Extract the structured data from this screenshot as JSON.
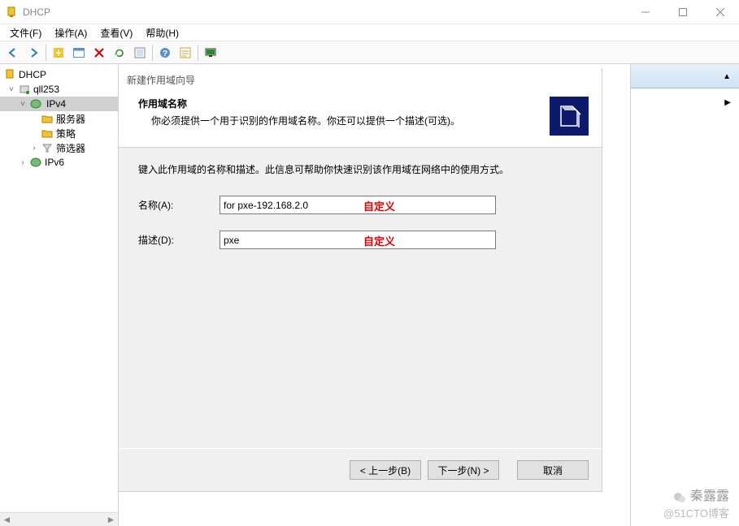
{
  "window": {
    "title": "DHCP"
  },
  "menu": {
    "file": "文件(F)",
    "action": "操作(A)",
    "view": "查看(V)",
    "help": "帮助(H)"
  },
  "tree": {
    "root": "DHCP",
    "server": "qll253",
    "ipv4": "IPv4",
    "srvopt": "服务器",
    "policy": "策略",
    "filter": "筛选器",
    "ipv6": "IPv6"
  },
  "wizard": {
    "dlgtitle": "新建作用域向导",
    "heading": "作用域名称",
    "subheading": "你必须提供一个用于识别的作用域名称。你还可以提供一个描述(可选)。",
    "instruction": "键入此作用域的名称和描述。此信息可帮助你快速识别该作用域在网络中的使用方式。",
    "name_label": "名称(A):",
    "name_value": "for pxe-192.168.2.0",
    "desc_label": "描述(D):",
    "desc_value": "pxe",
    "custom1": "自定义",
    "custom2": "自定义",
    "back": "< 上一步(B)",
    "next": "下一步(N) >",
    "cancel": "取消"
  },
  "watermark": {
    "line1": "秦露露",
    "line2": "@51CTO博客"
  }
}
